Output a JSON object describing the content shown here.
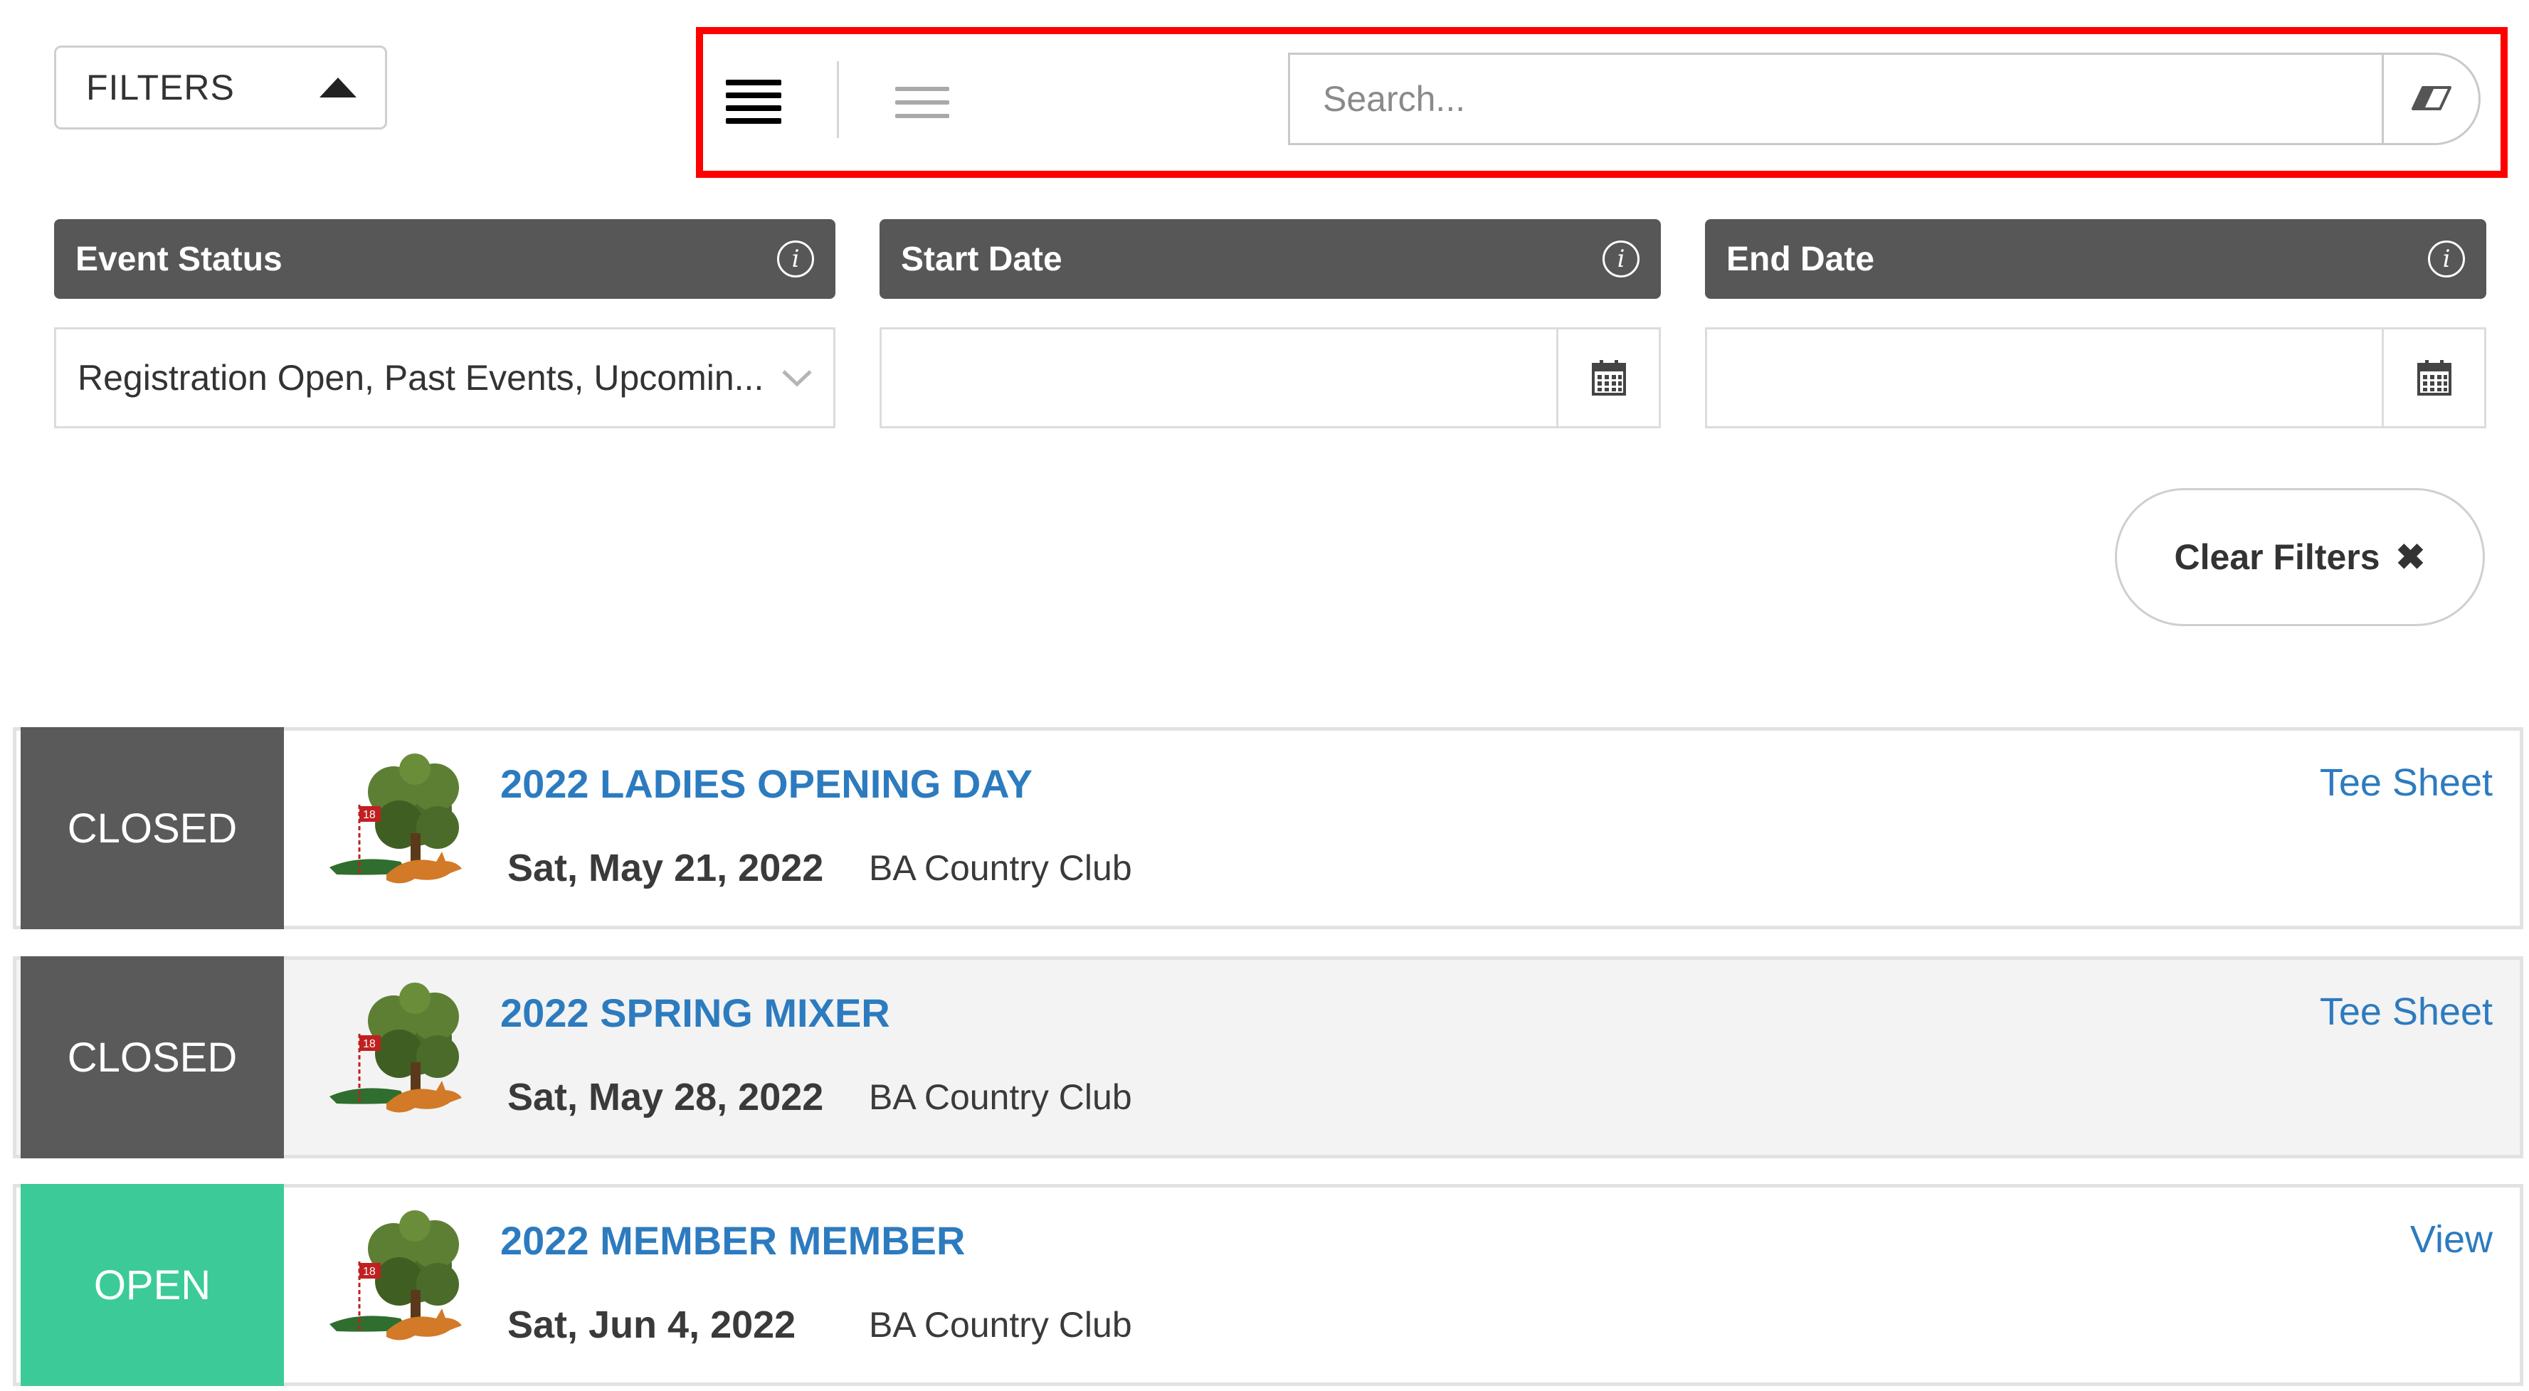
{
  "filters_toggle": {
    "label": "FILTERS"
  },
  "search": {
    "placeholder": "Search..."
  },
  "filter_columns": [
    {
      "header": "Event Status",
      "value": "Registration Open, Past Events, Upcomin..."
    },
    {
      "header": "Start Date",
      "value": ""
    },
    {
      "header": "End Date",
      "value": ""
    }
  ],
  "clear_filters": {
    "label": "Clear Filters",
    "icon": "✖"
  },
  "events": [
    {
      "status": "CLOSED",
      "title": "2022 LADIES OPENING DAY",
      "date": "Sat, May 21, 2022",
      "venue": "BA Country Club",
      "link": "Tee Sheet"
    },
    {
      "status": "CLOSED",
      "title": "2022 SPRING MIXER",
      "date": "Sat, May 28, 2022",
      "venue": "BA Country Club",
      "link": "Tee Sheet"
    },
    {
      "status": "OPEN",
      "title": "2022 MEMBER MEMBER",
      "date": "Sat, Jun 4, 2022",
      "venue": "BA Country Club",
      "link": "View"
    }
  ],
  "colors": {
    "highlight": "#ff0000",
    "header_bg": "#575757",
    "closed": "#5a5a5a",
    "open": "#3ccb98",
    "link": "#2d7bbf"
  },
  "icons": {
    "view_dense": "list-dense-icon",
    "view_relaxed": "list-relaxed-icon",
    "search_clear": "eraser-icon",
    "info": "info-icon",
    "calendar": "calendar-icon",
    "dropdown": "chevron-down-icon",
    "logo": "club-logo-tree-fox"
  }
}
